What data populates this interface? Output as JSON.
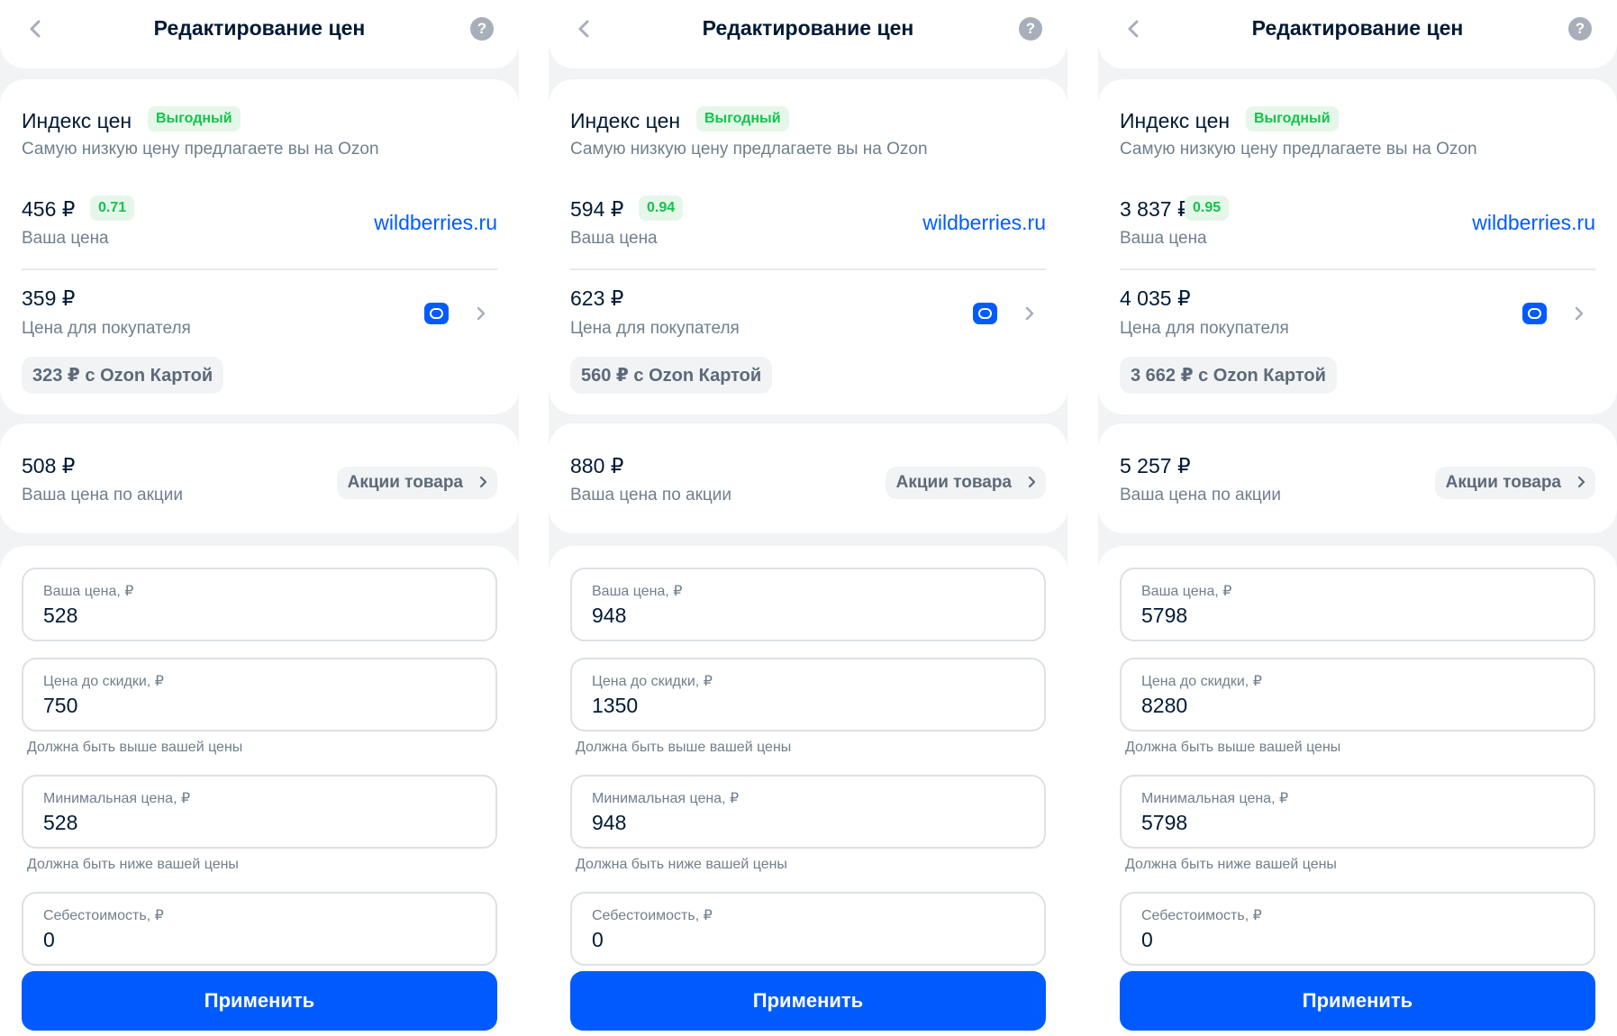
{
  "screens": [
    {
      "header": {
        "title": "Редактирование цен",
        "help_label": "?"
      },
      "price_index": {
        "title": "Индекс цен",
        "badge": "Выгодный",
        "subtitle": "Самую низкую цену предлагаете вы на Ozon",
        "your_price": "456 ₽",
        "index_value": "0.71",
        "your_price_label": "Ваша цена",
        "competitor": "wildberries.ru",
        "buyer_price": "359 ₽",
        "buyer_price_label": "Цена для покупателя",
        "ozon_card_price": "323 ₽ с Ozon Картой"
      },
      "promo": {
        "price": "508 ₽",
        "label": "Ваша цена по акции",
        "button": "Акции товара"
      },
      "form": {
        "your_price_label": "Ваша цена, ₽",
        "your_price_value": "528",
        "pre_discount_label": "Цена до скидки, ₽",
        "pre_discount_value": "750",
        "pre_discount_hint": "Должна быть выше вашей цены",
        "min_price_label": "Минимальная цена, ₽",
        "min_price_value": "528",
        "min_price_hint": "Должна быть ниже вашей цены",
        "cost_label": "Себестоимость, ₽",
        "cost_value": "0"
      },
      "apply_label": "Применить"
    },
    {
      "header": {
        "title": "Редактирование цен",
        "help_label": "?"
      },
      "price_index": {
        "title": "Индекс цен",
        "badge": "Выгодный",
        "subtitle": "Самую низкую цену предлагаете вы на Ozon",
        "your_price": "594 ₽",
        "index_value": "0.94",
        "your_price_label": "Ваша цена",
        "competitor": "wildberries.ru",
        "buyer_price": "623 ₽",
        "buyer_price_label": "Цена для покупателя",
        "ozon_card_price": "560 ₽ с Ozon Картой"
      },
      "promo": {
        "price": "880 ₽",
        "label": "Ваша цена по акции",
        "button": "Акции товара"
      },
      "form": {
        "your_price_label": "Ваша цена, ₽",
        "your_price_value": "948",
        "pre_discount_label": "Цена до скидки, ₽",
        "pre_discount_value": "1350",
        "pre_discount_hint": "Должна быть выше вашей цены",
        "min_price_label": "Минимальная цена, ₽",
        "min_price_value": "948",
        "min_price_hint": "Должна быть ниже вашей цены",
        "cost_label": "Себестоимость, ₽",
        "cost_value": "0"
      },
      "apply_label": "Применить"
    },
    {
      "header": {
        "title": "Редактирование цен",
        "help_label": "?"
      },
      "price_index": {
        "title": "Индекс цен",
        "badge": "Выгодный",
        "subtitle": "Самую низкую цену предлагаете вы на Ozon",
        "your_price": "3 837 ₽",
        "index_value": "0.95",
        "your_price_label": "Ваша цена",
        "competitor": "wildberries.ru",
        "buyer_price": "4 035 ₽",
        "buyer_price_label": "Цена для покупателя",
        "ozon_card_price": "3 662 ₽ с Ozon Картой"
      },
      "promo": {
        "price": "5 257 ₽",
        "label": "Ваша цена по акции",
        "button": "Акции товара"
      },
      "form": {
        "your_price_label": "Ваша цена, ₽",
        "your_price_value": "5798",
        "pre_discount_label": "Цена до скидки, ₽",
        "pre_discount_value": "8280",
        "pre_discount_hint": "Должна быть выше вашей цены",
        "min_price_label": "Минимальная цена, ₽",
        "min_price_value": "5798",
        "min_price_hint": "Должна быть ниже вашей цены",
        "cost_label": "Себестоимость, ₽",
        "cost_value": "0"
      },
      "apply_label": "Применить"
    }
  ],
  "icons": {
    "back": "chevron-left-icon",
    "help": "question-icon",
    "ozon_card": "ozon-card-icon",
    "chevron": "chevron-right-icon"
  },
  "colors": {
    "primary": "#005bff",
    "badge_green_text": "#10c44c",
    "badge_green_bg": "#e5f7e9",
    "background": "#f2f3f5",
    "secondary_text": "#707f8d"
  }
}
